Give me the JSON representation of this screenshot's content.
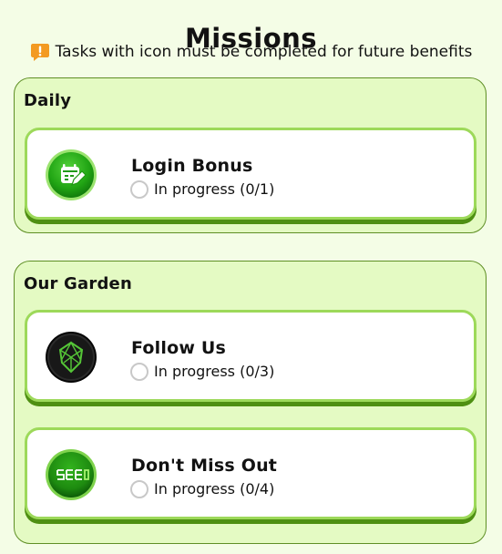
{
  "page": {
    "title": "Missions",
    "notice": "Tasks with icon must be completed for future benefits"
  },
  "colors": {
    "background": "#f4fde6",
    "section_background": "#e4fac3",
    "card_border": "#9dd95a",
    "card_shadow": "#4e8f12",
    "notice_icon": "#f39a22"
  },
  "sections": [
    {
      "title": "Daily",
      "missions": [
        {
          "title": "Login Bonus",
          "status": "In progress (0/1)",
          "icon": "calendar-edit-icon"
        }
      ]
    },
    {
      "title": "Our Garden",
      "missions": [
        {
          "title": "Follow Us",
          "status": "In progress (0/3)",
          "icon": "crystal-logo-icon"
        },
        {
          "title": "Don't Miss Out",
          "status": "In progress (0/4)",
          "icon": "seed-logo-icon"
        }
      ]
    }
  ]
}
